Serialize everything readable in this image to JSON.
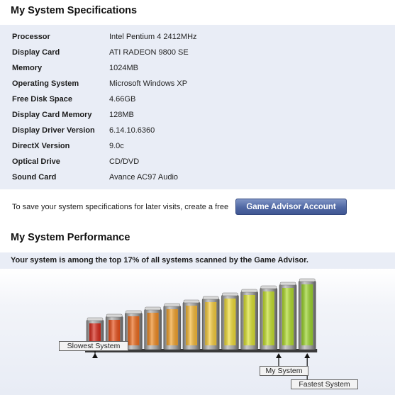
{
  "specs": {
    "title": "My System Specifications",
    "rows": [
      {
        "label": "Processor",
        "value": "Intel Pentium 4 2412MHz"
      },
      {
        "label": "Display Card",
        "value": "ATI RADEON 9800 SE"
      },
      {
        "label": "Memory",
        "value": "1024MB"
      },
      {
        "label": "Operating System",
        "value": "Microsoft Windows XP"
      },
      {
        "label": "Free Disk Space",
        "value": "4.66GB"
      },
      {
        "label": "Display Card Memory",
        "value": "128MB"
      },
      {
        "label": "Display Driver Version",
        "value": "6.14.10.6360"
      },
      {
        "label": "DirectX Version",
        "value": "9.0c"
      },
      {
        "label": "Optical Drive",
        "value": "CD/DVD"
      },
      {
        "label": "Sound Card",
        "value": "Avance AC97 Audio"
      }
    ]
  },
  "save": {
    "text": "To save your system specifications for later visits, create a free",
    "button_label": "Game Advisor Account"
  },
  "performance": {
    "title": "My System Performance",
    "summary": "Your system is among the top 17% of all systems scanned by the Game Advisor.",
    "top_percent": 17,
    "markers": {
      "slowest": "Slowest System",
      "mine": "My System",
      "fastest": "Fastest System"
    },
    "colors": [
      "#d8281a",
      "#e84e18",
      "#ed6a1a",
      "#f08a20",
      "#f3a22a",
      "#f6b935",
      "#f7cc3b",
      "#f0dc35",
      "#dbe22e",
      "#c4e02c",
      "#b0dc2b",
      "#9bd52b"
    ],
    "my_bar_index": 10
  }
}
